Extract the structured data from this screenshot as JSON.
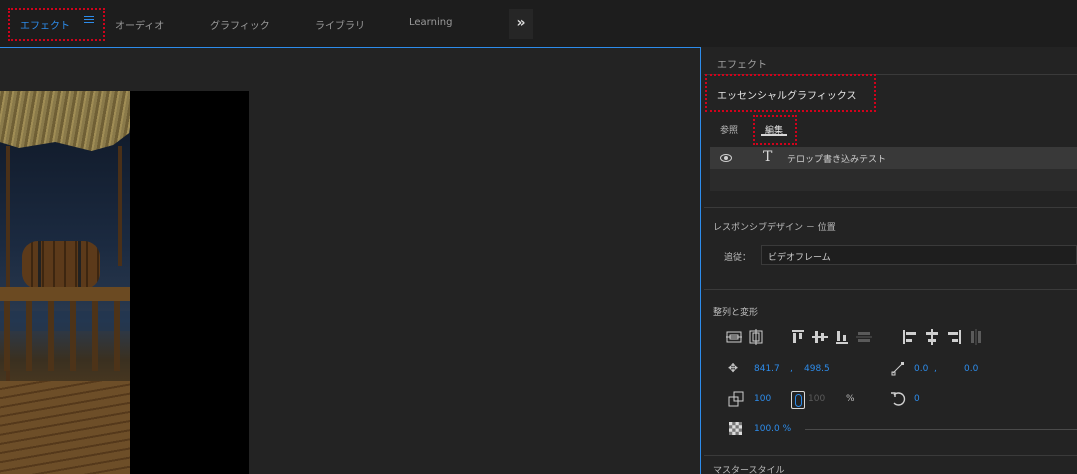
{
  "workspace_tabs": {
    "effects": "エフェクト",
    "audio": "オーディオ",
    "graphics": "グラフィック",
    "libraries": "ライブラリ",
    "learning": "Learning",
    "overflow": "»"
  },
  "panel": {
    "title": "エフェクト",
    "section": "エッセンシャルグラフィックス",
    "tabs": {
      "browse": "参照",
      "edit": "編集"
    },
    "layer": {
      "name": "テロップ書き込みテスト"
    },
    "responsive": {
      "title": "レスポンシブデザイン － 位置",
      "follow_label": "追従：",
      "follow_value": "ビデオフレーム"
    },
    "transform": {
      "title": "整列と変形",
      "position_x": "841.7",
      "position_sep": ",",
      "position_y": "498.5",
      "anchor_x": "0.0",
      "anchor_sep": ",",
      "anchor_y": "0.0",
      "scale": "100",
      "scale_locked": "100",
      "percent": "%",
      "rotation": "0",
      "opacity": "100.0 %"
    },
    "master_style": {
      "title": "マスタースタイル"
    }
  },
  "colors": {
    "accent": "#2d8ceb",
    "highlight": "#d0021b"
  },
  "icons": [
    "hamburger-icon",
    "double-chevron-icon",
    "eye-icon",
    "text-layer-icon",
    "align-icon",
    "move-icon",
    "anchor-icon",
    "scale-icon",
    "link-icon",
    "rotate-icon",
    "opacity-icon"
  ]
}
